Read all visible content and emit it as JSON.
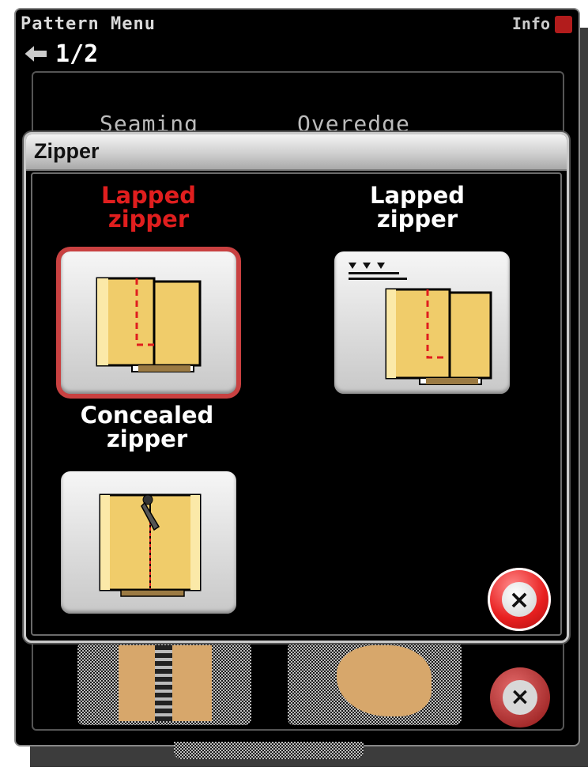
{
  "background_window": {
    "title": "Pattern Menu",
    "title_right": "Info",
    "page_indicator": "1/2",
    "tabs": [
      "Seaming",
      "Overedge"
    ]
  },
  "dialog": {
    "title": "Zipper",
    "options": [
      {
        "label_line1": "Lapped",
        "label_line2": "zipper",
        "selected": true,
        "icon": "lapped-zipper-icon"
      },
      {
        "label_line1": "Lapped",
        "label_line2": "zipper",
        "selected": false,
        "icon": "lapped-zipper-feed-icon"
      },
      {
        "label_line1": "Concealed",
        "label_line2": "zipper",
        "selected": false,
        "icon": "concealed-zipper-icon"
      }
    ],
    "close_symbol": "×"
  },
  "colors": {
    "selected_label": "#e01e1e",
    "fabric": "#f0cc6a",
    "stitch": "#e01e1e",
    "close_button": "#e81f1f"
  }
}
